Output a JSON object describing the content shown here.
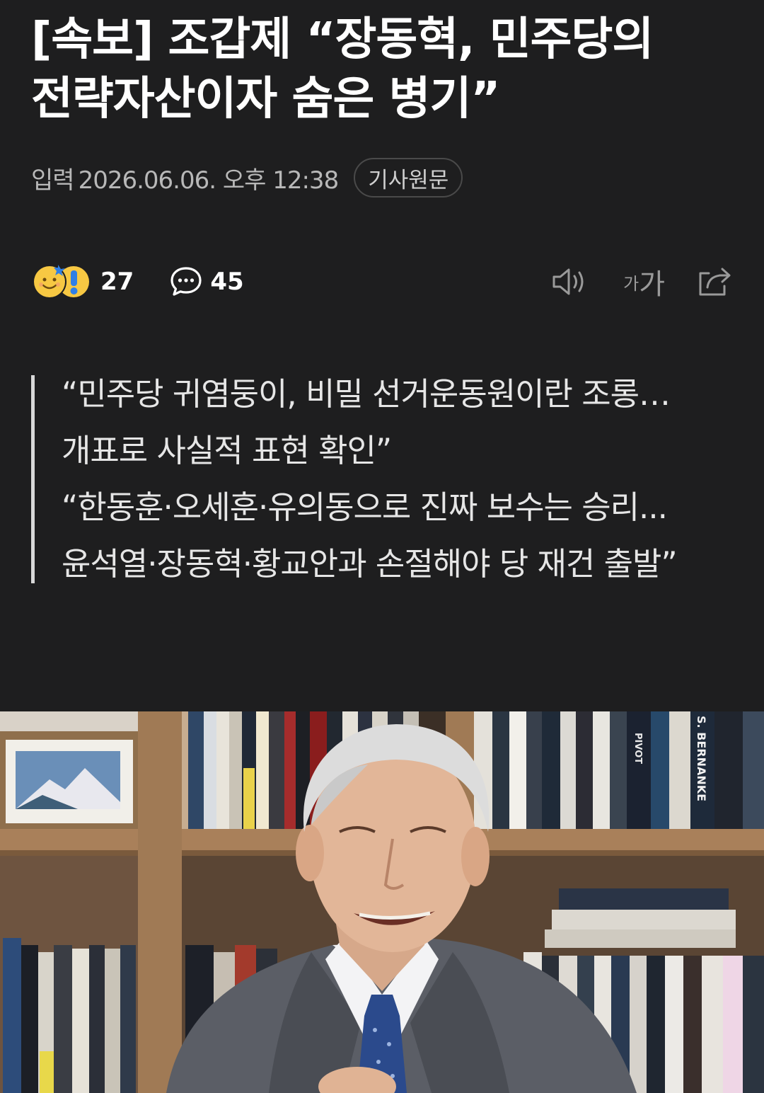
{
  "article": {
    "headline": "[속보] 조갑제 “장동혁, 민주당의 전략자산이자 숨은 병기”",
    "meta": {
      "input_label": "입력",
      "date": "2026.06.06. 오후 12:38",
      "original_button": "기사원문"
    },
    "actions": {
      "reaction_count": "27",
      "comment_count": "45",
      "font_small": "가",
      "font_big": "가"
    },
    "summary": [
      "“민주당 귀염둥이, 비밀 선거운동원이란 조롱…개표로 사실적 표현 확인”",
      "“한동훈·오세훈·유의동으로 진짜 보수는 승리... 윤석열·장동혁·황교안과 손절해야 당 재건 출발”"
    ],
    "photo": {
      "book_spines": [
        "S. BERNANKE",
        "PIVOT"
      ]
    }
  },
  "colors": {
    "background": "#1e1e1f",
    "headline": "#ffffff",
    "meta_text": "#b8b8b8",
    "summary_text": "#e6e6e6",
    "summary_bar": "#d8d8d8",
    "icon_gray": "#9a9a9a",
    "emoji_yellow": "#f7c843",
    "emoji_blue": "#2f7fe6"
  },
  "icons": [
    "smile-reaction-icon",
    "surprise-reaction-icon",
    "comment-icon",
    "speaker-icon",
    "font-size-icon",
    "share-icon"
  ]
}
